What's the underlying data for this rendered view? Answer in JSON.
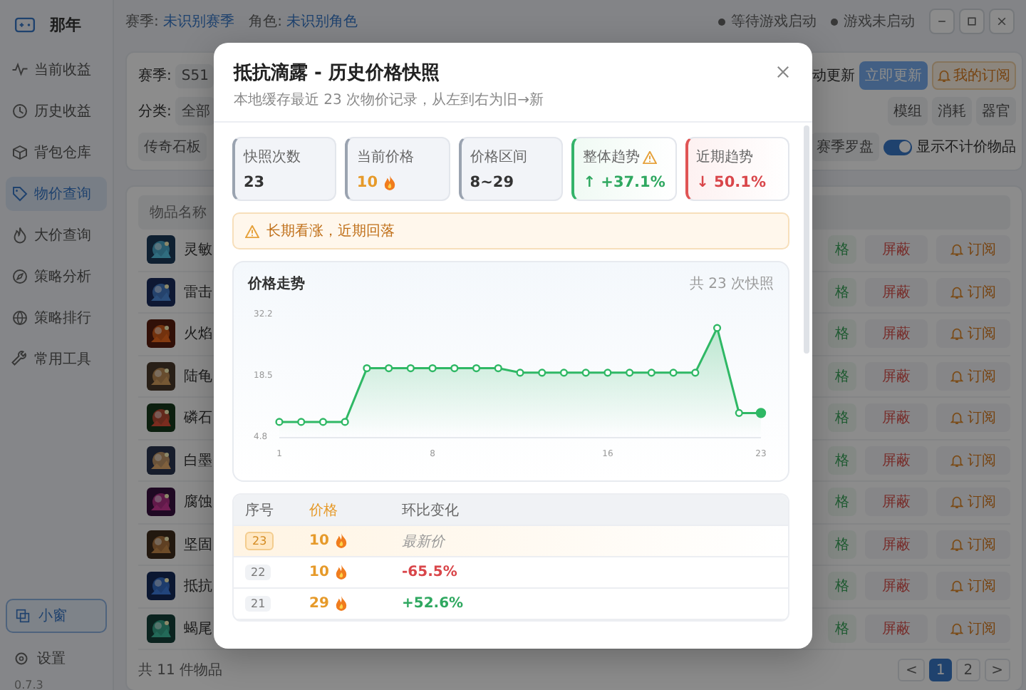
{
  "app": {
    "title": "那年",
    "version": "0.7.3"
  },
  "sidebar": {
    "items": [
      {
        "label": "当前收益",
        "selected": false
      },
      {
        "label": "历史收益",
        "selected": false
      },
      {
        "label": "背包仓库",
        "selected": false
      },
      {
        "label": "物价查询",
        "selected": true
      },
      {
        "label": "大价查询",
        "selected": false
      },
      {
        "label": "策略分析",
        "selected": false
      },
      {
        "label": "策略排行",
        "selected": false
      },
      {
        "label": "常用工具",
        "selected": false
      }
    ],
    "compact_button": "小窗",
    "settings": "设置"
  },
  "topbar": {
    "season_label": "赛季:",
    "season": "未识别赛季",
    "role_label": "角色:",
    "role": "未识别角色",
    "statuses": [
      "等待游戏启动",
      "游戏未启动"
    ]
  },
  "filters": {
    "season_label": "赛季:",
    "season_value": "S51",
    "auto_update": "动更新",
    "refresh_button": "立即更新",
    "subscriptions_button": "我的订阅",
    "category_label": "分类:",
    "categories_left": [
      "全部"
    ],
    "categories_right": [
      "模组",
      "消耗",
      "器官"
    ],
    "categories_row2_left": [
      "传奇石板"
    ],
    "categories_row2_right": [
      "赛季罗盘"
    ],
    "show_unpriced": {
      "label": "显示不计价物品",
      "on": true
    }
  },
  "items_table": {
    "header": "物品名称",
    "rows": [
      {
        "name": "灵敏",
        "sell": "格",
        "block": "屏蔽",
        "subscribe": "订阅"
      },
      {
        "name": "雷击",
        "sell": "格",
        "block": "屏蔽",
        "subscribe": "订阅"
      },
      {
        "name": "火焰",
        "sell": "格",
        "block": "屏蔽",
        "subscribe": "订阅"
      },
      {
        "name": "陆龟",
        "sell": "格",
        "block": "屏蔽",
        "subscribe": "订阅"
      },
      {
        "name": "磷石",
        "sell": "格",
        "block": "屏蔽",
        "subscribe": "订阅"
      },
      {
        "name": "白墨",
        "sell": "格",
        "block": "屏蔽",
        "subscribe": "订阅"
      },
      {
        "name": "腐蚀",
        "sell": "格",
        "block": "屏蔽",
        "subscribe": "订阅"
      },
      {
        "name": "坚固",
        "sell": "格",
        "block": "屏蔽",
        "subscribe": "订阅"
      },
      {
        "name": "抵抗",
        "sell": "格",
        "block": "屏蔽",
        "subscribe": "订阅"
      },
      {
        "name": "蝎尾",
        "sell": "格",
        "block": "屏蔽",
        "subscribe": "订阅"
      }
    ],
    "total": "共 11 件物品",
    "pages": [
      {
        "label": "1",
        "selected": true
      },
      {
        "label": "2",
        "selected": false
      }
    ],
    "prev": "<",
    "next": ">"
  },
  "modal": {
    "title": "抵抗滴露 - 历史价格快照",
    "subtitle": "本地缓存最近 23 次物价记录，从左到右为旧→新",
    "stats": [
      {
        "label": "快照次数",
        "value": "23",
        "kind": "neutral",
        "flame": false,
        "warning": false
      },
      {
        "label": "当前价格",
        "value": "10",
        "kind": "price",
        "flame": true,
        "warning": false
      },
      {
        "label": "价格区间",
        "value": "8~29",
        "kind": "neutral",
        "flame": false,
        "warning": false
      },
      {
        "label": "整体趋势",
        "value": "↑ +37.1%",
        "kind": "up",
        "flame": false,
        "warning": true
      },
      {
        "label": "近期趋势",
        "value": "↓ 50.1%",
        "kind": "down",
        "flame": false,
        "warning": false
      }
    ],
    "alert": "长期看涨，近期回落",
    "chart_title": "价格走势",
    "chart_count": "共 23 次快照",
    "chart_data": {
      "type": "area",
      "x": [
        1,
        2,
        3,
        4,
        5,
        6,
        7,
        8,
        9,
        10,
        11,
        12,
        13,
        14,
        15,
        16,
        17,
        18,
        19,
        20,
        21,
        22,
        23
      ],
      "series": [
        {
          "color": "#2fb865",
          "values": [
            8,
            8,
            8,
            8,
            20,
            20,
            20,
            20,
            20,
            20,
            20,
            19,
            19,
            19,
            19,
            19,
            19,
            19,
            19,
            19,
            29,
            10,
            10
          ]
        }
      ],
      "xlim": [
        1,
        23
      ],
      "ylim": [
        4.8,
        32.2
      ],
      "yticks": [
        4.8,
        18.5,
        32.2
      ],
      "xticks": [
        1,
        8,
        16,
        23
      ]
    },
    "history": {
      "columns": [
        "序号",
        "价格",
        "环比变化"
      ],
      "rows": [
        {
          "index": "23",
          "price": "10",
          "change": "最新价",
          "kind": "latest",
          "highlighted": true
        },
        {
          "index": "22",
          "price": "10",
          "change": "-65.5%",
          "kind": "down",
          "highlighted": false
        },
        {
          "index": "21",
          "price": "29",
          "change": "+52.6%",
          "kind": "up",
          "highlighted": false
        }
      ]
    }
  }
}
